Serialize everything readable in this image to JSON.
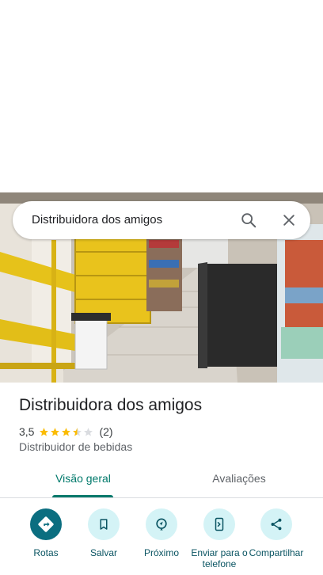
{
  "search": {
    "query": "Distribuidora dos amigos"
  },
  "place": {
    "name": "Distribuidora dos amigos",
    "rating": "3,5",
    "rating_value": 3.5,
    "rating_max": 5,
    "review_count": "(2)",
    "category": "Distribuidor de bebidas"
  },
  "tabs": [
    {
      "label": "Visão geral",
      "selected": true
    },
    {
      "label": "Avaliações",
      "selected": false
    }
  ],
  "actions": [
    {
      "label": "Rotas",
      "icon": "directions-icon"
    },
    {
      "label": "Salvar",
      "icon": "bookmark-icon"
    },
    {
      "label": "Próximo",
      "icon": "nearby-icon"
    },
    {
      "label": "Enviar para o telefone",
      "icon": "send-to-phone-icon"
    },
    {
      "label": "Compartilhar",
      "icon": "share-icon"
    }
  ],
  "colors": {
    "accent": "#00796b",
    "action_bg": "#d4f3f6",
    "action_primary": "#0b6e80",
    "star": "#fbbc04"
  }
}
